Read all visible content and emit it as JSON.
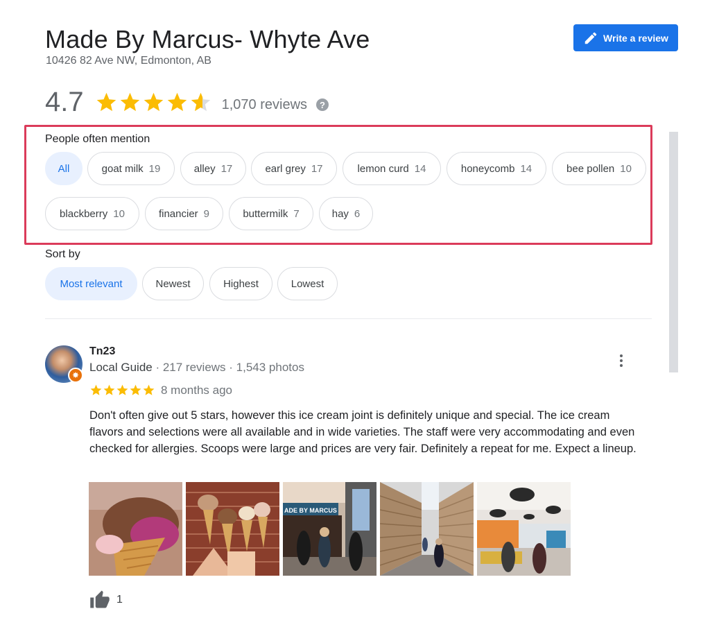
{
  "place": {
    "title": "Made By Marcus- Whyte Ave",
    "address": "10426 82 Ave NW, Edmonton, AB"
  },
  "write_review": {
    "label": "Write a review",
    "icon": "pencil-icon"
  },
  "rating": {
    "value": "4.7",
    "stars": 4.7,
    "review_count": "1,070 reviews",
    "help_icon": "?"
  },
  "mentions": {
    "label": "People often mention",
    "chips": [
      {
        "label": "All",
        "count": ""
      },
      {
        "label": "goat milk",
        "count": "19"
      },
      {
        "label": "alley",
        "count": "17"
      },
      {
        "label": "earl grey",
        "count": "17"
      },
      {
        "label": "lemon curd",
        "count": "14"
      },
      {
        "label": "honeycomb",
        "count": "14"
      },
      {
        "label": "bee pollen",
        "count": "10"
      },
      {
        "label": "blackberry",
        "count": "10"
      },
      {
        "label": "financier",
        "count": "9"
      },
      {
        "label": "buttermilk",
        "count": "7"
      },
      {
        "label": "hay",
        "count": "6"
      }
    ]
  },
  "sort": {
    "label": "Sort by",
    "options": [
      "Most relevant",
      "Newest",
      "Highest",
      "Lowest"
    ]
  },
  "review": {
    "name": "Tn23",
    "guide": "Local Guide",
    "stats": " · 217 reviews · 1,543 photos",
    "stars": 5,
    "time": "8 months ago",
    "text": "Don't often give out 5 stars, however this ice cream joint is definitely unique and special. The ice cream flavors and selections were all available and in wide varieties. The staff were very accommodating and even checked for allergies. Scoops were large and prices are very fair.  Definitely a repeat for me. Expect a lineup.",
    "photo_text": "ADE BY MARCUS",
    "likes": "1"
  },
  "colors": {
    "accent": "#1a73e8",
    "star": "#fbbc04",
    "highlight_border": "#db3b5a",
    "selected_chip_bg": "#e8f0fe"
  }
}
